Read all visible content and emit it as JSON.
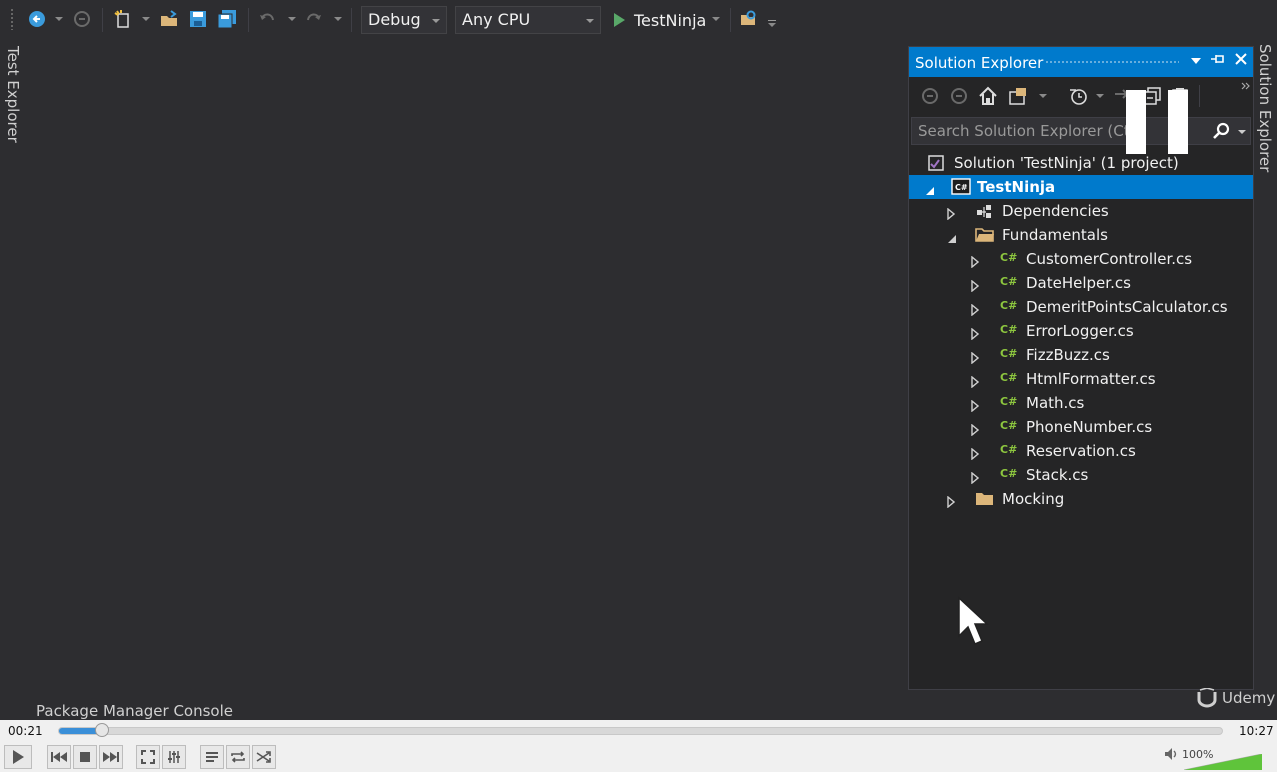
{
  "toolbar": {
    "config_value": "Debug",
    "platform_value": "Any CPU",
    "run_label": "TestNinja"
  },
  "side_tabs": {
    "left": "Test Explorer",
    "right": "Solution Explorer"
  },
  "solution_explorer": {
    "title": "Solution Explorer",
    "search_placeholder": "Search Solution Explorer (Ctrl",
    "solution_label": "Solution 'TestNinja' (1 project)",
    "project_label": "TestNinja",
    "dependencies_label": "Dependencies",
    "folder_fundamentals": "Fundamentals",
    "files": [
      "CustomerController.cs",
      "DateHelper.cs",
      "DemeritPointsCalculator.cs",
      "ErrorLogger.cs",
      "FizzBuzz.cs",
      "HtmlFormatter.cs",
      "Math.cs",
      "PhoneNumber.cs",
      "Reservation.cs",
      "Stack.cs"
    ],
    "folder_mocking": "Mocking",
    "cs_icon_text": "C#"
  },
  "bottom": {
    "package_manager": "Package Manager Console",
    "brand": "Udemy"
  },
  "player": {
    "elapsed": "00:21",
    "total": "10:27",
    "progress": 0.033,
    "volume_label": "100%",
    "volume": 1.0
  },
  "colors": {
    "accent": "#007acc",
    "background": "#2d2d30",
    "panel": "#252526",
    "run_green": "#59a869",
    "cs_green": "#8dc63f"
  }
}
